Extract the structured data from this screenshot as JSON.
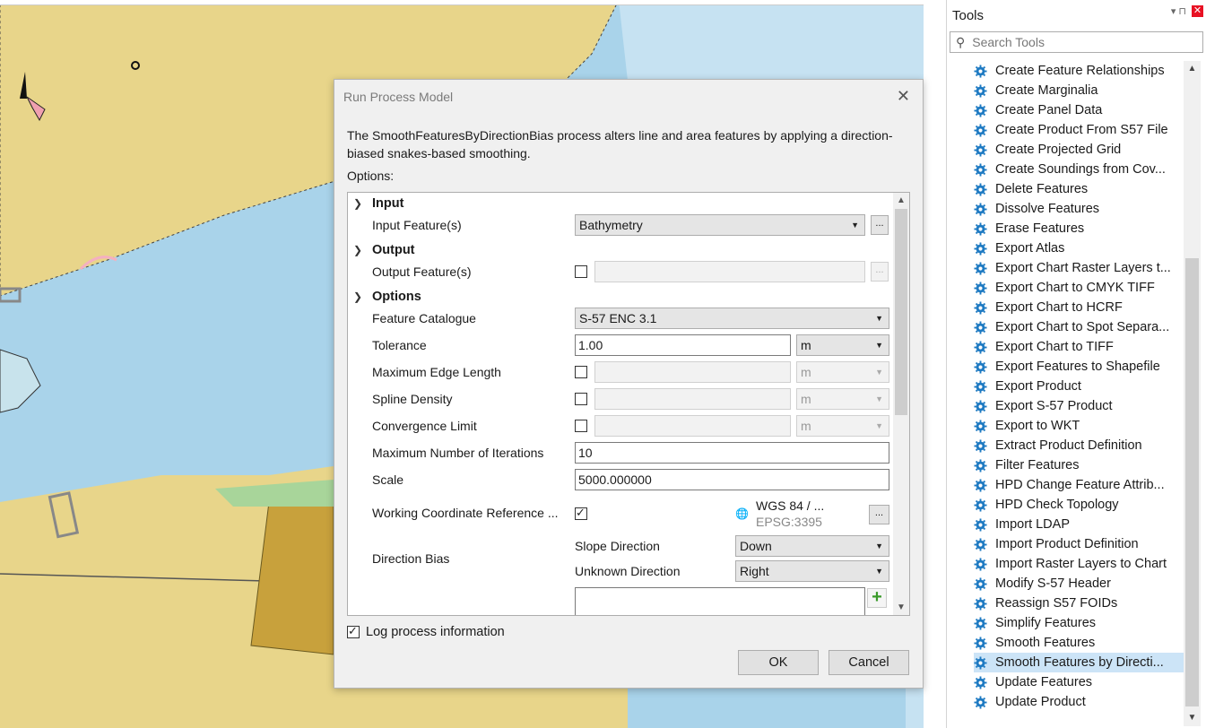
{
  "tools_panel": {
    "title": "Tools",
    "search_placeholder": "Search Tools",
    "pin_label": "▾ ⊓",
    "close_label": "✕",
    "items": [
      {
        "label": "Create Feature Relationships"
      },
      {
        "label": "Create Marginalia"
      },
      {
        "label": "Create Panel Data"
      },
      {
        "label": "Create Product From S57 File"
      },
      {
        "label": "Create Projected Grid"
      },
      {
        "label": "Create Soundings from Cov..."
      },
      {
        "label": "Delete Features"
      },
      {
        "label": "Dissolve Features"
      },
      {
        "label": "Erase Features"
      },
      {
        "label": "Export Atlas"
      },
      {
        "label": "Export Chart Raster Layers t..."
      },
      {
        "label": "Export Chart to CMYK TIFF"
      },
      {
        "label": "Export Chart to HCRF"
      },
      {
        "label": "Export Chart to Spot Separa..."
      },
      {
        "label": "Export Chart to TIFF"
      },
      {
        "label": "Export Features to Shapefile"
      },
      {
        "label": "Export Product"
      },
      {
        "label": "Export S-57 Product"
      },
      {
        "label": "Export to WKT"
      },
      {
        "label": "Extract Product Definition"
      },
      {
        "label": "Filter Features"
      },
      {
        "label": "HPD Change Feature Attrib..."
      },
      {
        "label": "HPD Check Topology"
      },
      {
        "label": "Import LDAP"
      },
      {
        "label": "Import Product Definition"
      },
      {
        "label": "Import Raster Layers to Chart"
      },
      {
        "label": "Modify S-57 Header"
      },
      {
        "label": "Reassign S57 FOIDs"
      },
      {
        "label": "Simplify Features"
      },
      {
        "label": "Smooth Features"
      },
      {
        "label": "Smooth Features by Directi..."
      },
      {
        "label": "Update Features"
      },
      {
        "label": "Update Product"
      }
    ],
    "selected_index": 30
  },
  "dialog": {
    "title": "Run Process Model",
    "description": "The SmoothFeaturesByDirectionBias process alters line and area features by applying a direction-biased snakes-based smoothing.",
    "options_label": "Options:",
    "sections": {
      "input": "Input",
      "output": "Output",
      "options": "Options"
    },
    "fields": {
      "input_features_label": "Input Feature(s)",
      "input_features_value": "Bathymetry",
      "output_features_label": "Output Feature(s)",
      "feature_catalogue_label": "Feature Catalogue",
      "feature_catalogue_value": "S-57 ENC 3.1",
      "tolerance_label": "Tolerance",
      "tolerance_value": "1.00",
      "tolerance_unit": "m",
      "max_edge_length_label": "Maximum Edge Length",
      "max_edge_length_unit": "m",
      "spline_density_label": "Spline Density",
      "spline_density_unit": "m",
      "convergence_limit_label": "Convergence Limit",
      "convergence_limit_unit": "m",
      "max_iterations_label": "Maximum Number of Iterations",
      "max_iterations_value": "10",
      "scale_label": "Scale",
      "scale_value": "5000.000000",
      "working_crs_label": "Working Coordinate Reference ...",
      "working_crs_name": "WGS 84 / ...",
      "working_crs_code": "EPSG:3395",
      "direction_bias_label": "Direction Bias",
      "slope_direction_label": "Slope Direction",
      "slope_direction_value": "Down",
      "unknown_direction_label": "Unknown Direction",
      "unknown_direction_value": "Right"
    },
    "ellipsis": "...",
    "log_label": "Log process information",
    "ok_label": "OK",
    "cancel_label": "Cancel"
  }
}
